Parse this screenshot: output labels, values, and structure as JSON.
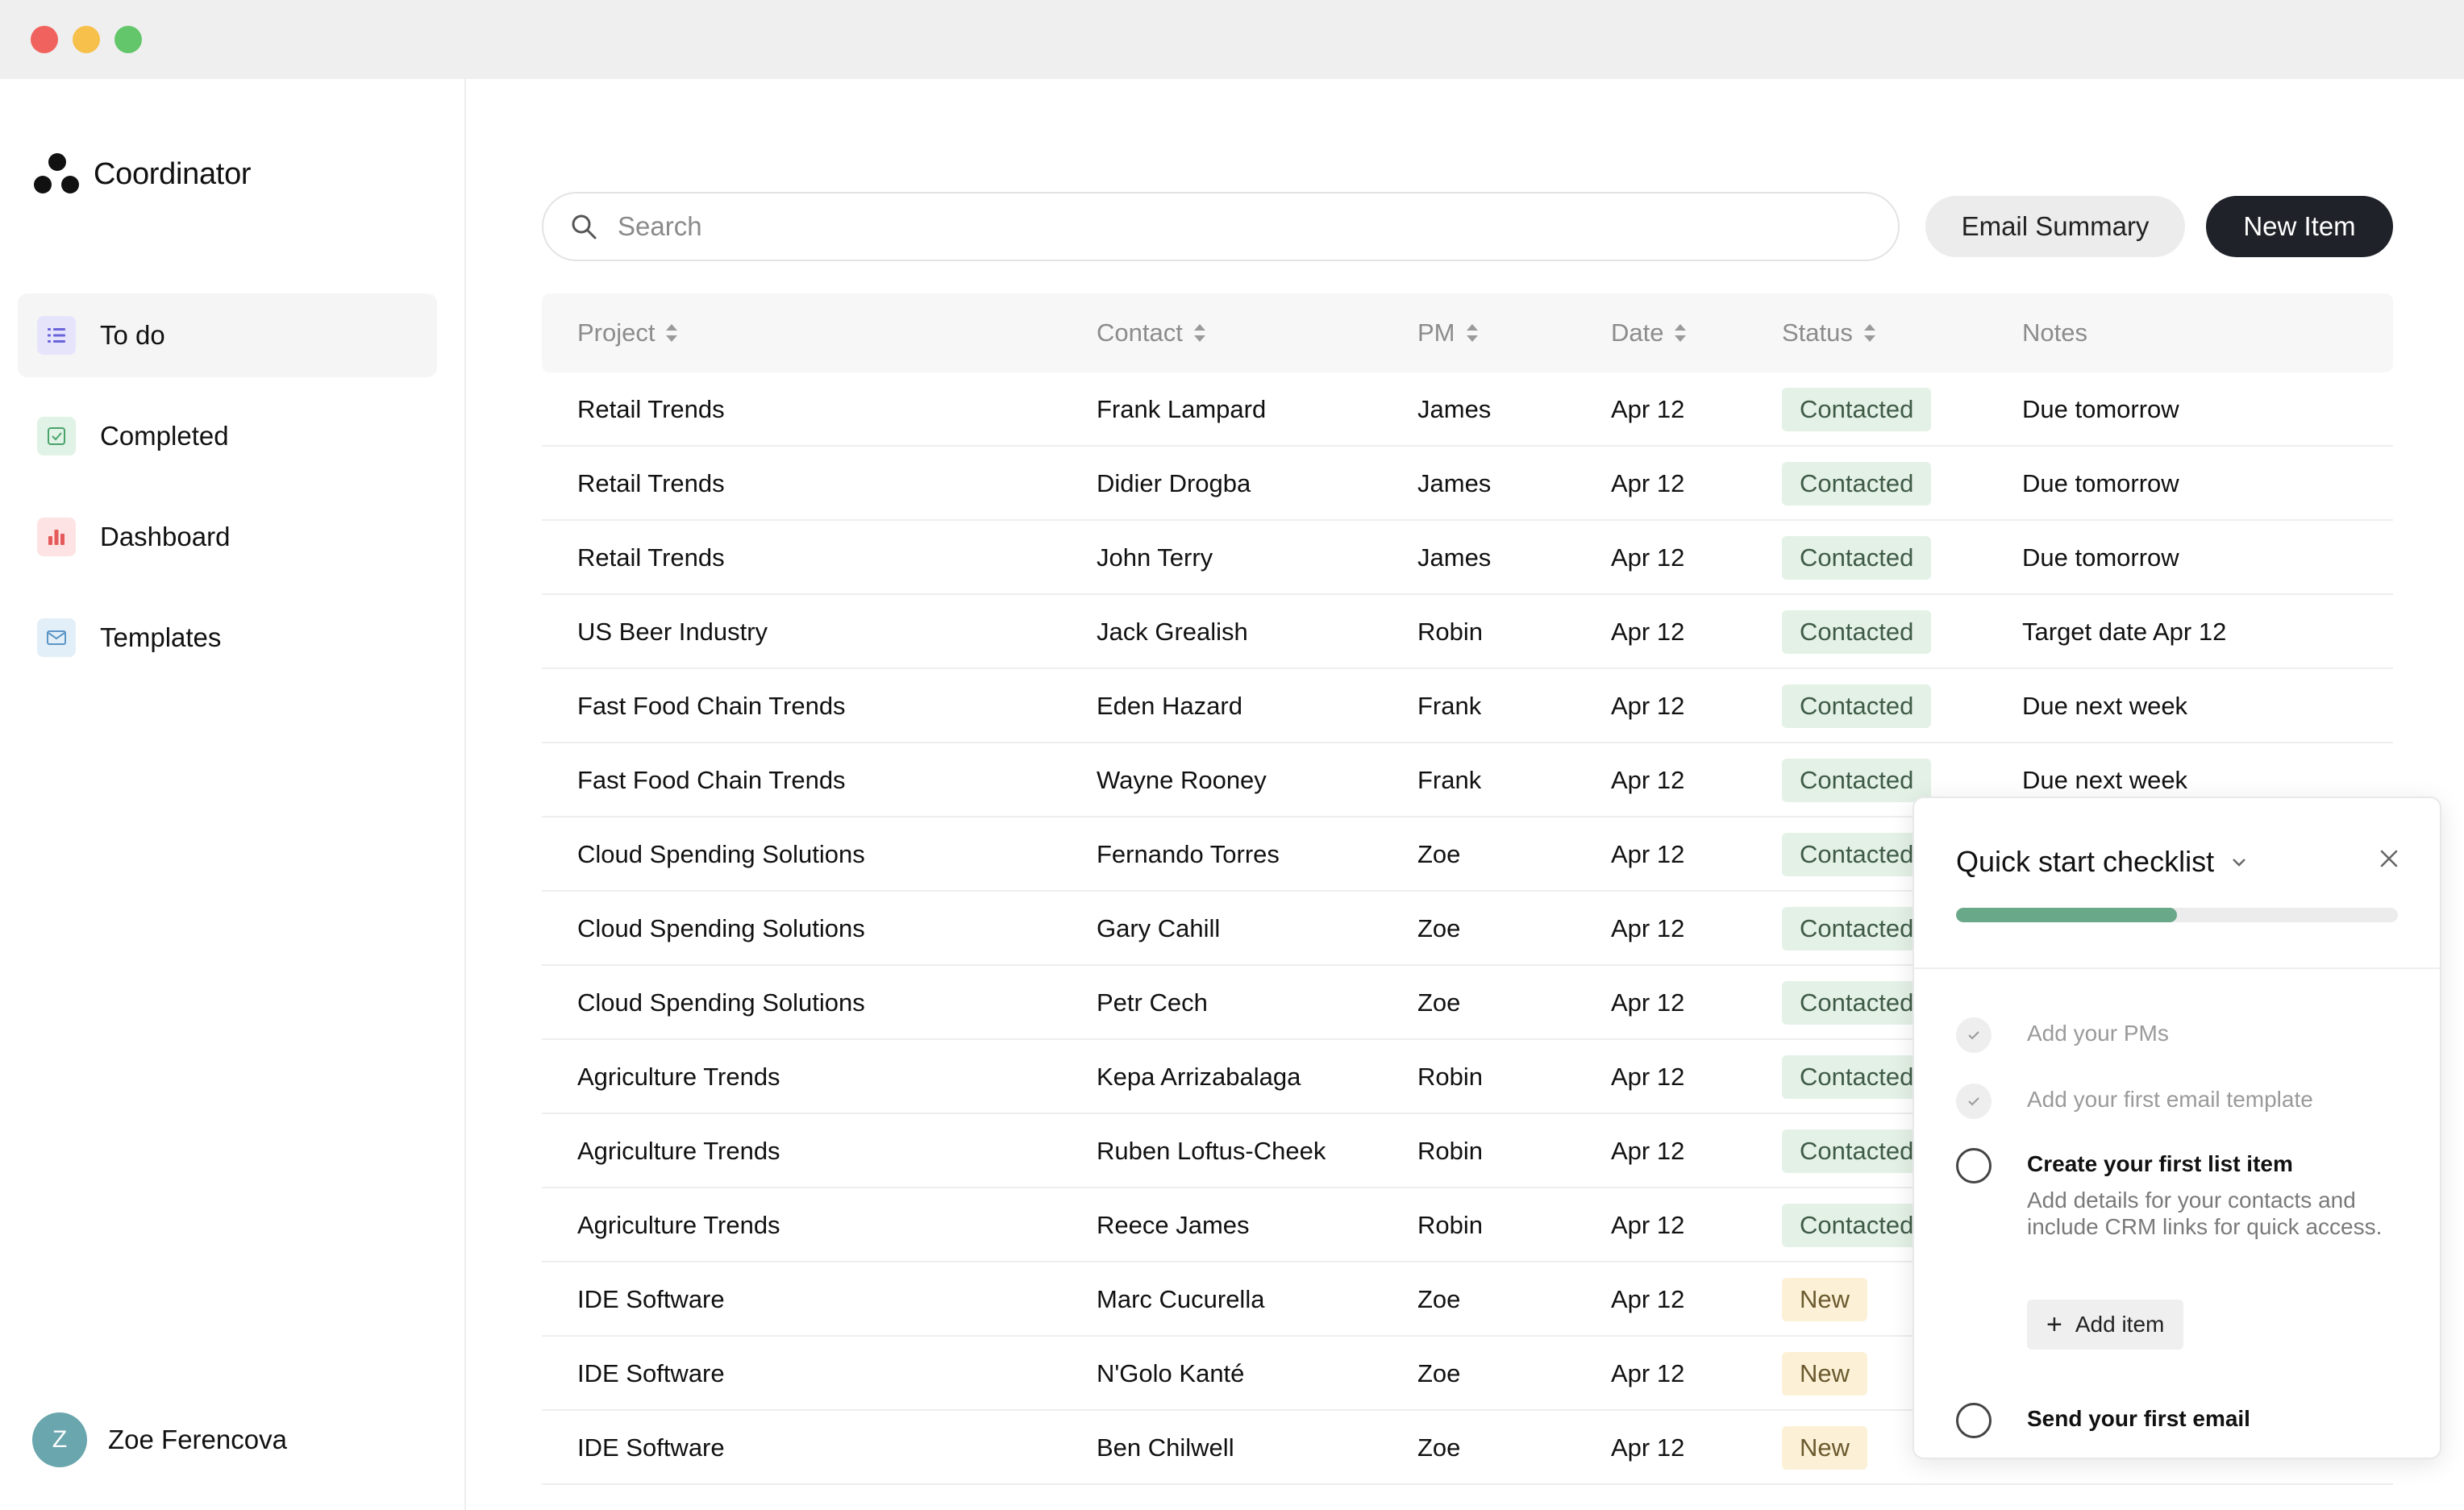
{
  "app": {
    "name": "Coordinator"
  },
  "sidebar": {
    "items": [
      {
        "label": "To do",
        "icon": "list-icon",
        "active": true
      },
      {
        "label": "Completed",
        "icon": "check-square-icon",
        "active": false
      },
      {
        "label": "Dashboard",
        "icon": "bar-chart-icon",
        "active": false
      },
      {
        "label": "Templates",
        "icon": "mail-icon",
        "active": false
      }
    ],
    "user": {
      "initial": "Z",
      "name": "Zoe Ferencova"
    }
  },
  "search": {
    "placeholder": "Search",
    "value": ""
  },
  "toolbar": {
    "email_summary_label": "Email Summary",
    "new_item_label": "New Item"
  },
  "table": {
    "headers": {
      "project": "Project",
      "contact": "Contact",
      "pm": "PM",
      "date": "Date",
      "status": "Status",
      "notes": "Notes"
    },
    "rows": [
      {
        "project": "Retail Trends",
        "contact": "Frank Lampard",
        "pm": "James",
        "date": "Apr 12",
        "status": "Contacted",
        "notes": "Due tomorrow"
      },
      {
        "project": "Retail Trends",
        "contact": "Didier Drogba",
        "pm": "James",
        "date": "Apr 12",
        "status": "Contacted",
        "notes": "Due tomorrow"
      },
      {
        "project": "Retail Trends",
        "contact": "John Terry",
        "pm": "James",
        "date": "Apr 12",
        "status": "Contacted",
        "notes": "Due tomorrow"
      },
      {
        "project": "US Beer Industry",
        "contact": "Jack Grealish",
        "pm": "Robin",
        "date": "Apr 12",
        "status": "Contacted",
        "notes": "Target date Apr 12"
      },
      {
        "project": "Fast Food Chain Trends",
        "contact": "Eden Hazard",
        "pm": "Frank",
        "date": "Apr 12",
        "status": "Contacted",
        "notes": "Due next week"
      },
      {
        "project": "Fast Food Chain Trends",
        "contact": "Wayne Rooney",
        "pm": "Frank",
        "date": "Apr 12",
        "status": "Contacted",
        "notes": "Due next week"
      },
      {
        "project": "Cloud Spending Solutions",
        "contact": "Fernando Torres",
        "pm": "Zoe",
        "date": "Apr 12",
        "status": "Contacted",
        "notes": ""
      },
      {
        "project": "Cloud Spending Solutions",
        "contact": "Gary Cahill",
        "pm": "Zoe",
        "date": "Apr 12",
        "status": "Contacted",
        "notes": ""
      },
      {
        "project": "Cloud Spending Solutions",
        "contact": "Petr Cech",
        "pm": "Zoe",
        "date": "Apr 12",
        "status": "Contacted",
        "notes": ""
      },
      {
        "project": "Agriculture Trends",
        "contact": "Kepa Arrizabalaga",
        "pm": "Robin",
        "date": "Apr 12",
        "status": "Contacted",
        "notes": ""
      },
      {
        "project": "Agriculture Trends",
        "contact": "Ruben Loftus-Cheek",
        "pm": "Robin",
        "date": "Apr 12",
        "status": "Contacted",
        "notes": ""
      },
      {
        "project": "Agriculture Trends",
        "contact": "Reece James",
        "pm": "Robin",
        "date": "Apr 12",
        "status": "Contacted",
        "notes": ""
      },
      {
        "project": "IDE Software",
        "contact": "Marc Cucurella",
        "pm": "Zoe",
        "date": "Apr 12",
        "status": "New",
        "notes": ""
      },
      {
        "project": "IDE Software",
        "contact": "N'Golo Kanté",
        "pm": "Zoe",
        "date": "Apr 12",
        "status": "New",
        "notes": ""
      },
      {
        "project": "IDE Software",
        "contact": "Ben Chilwell",
        "pm": "Zoe",
        "date": "Apr 12",
        "status": "New",
        "notes": ""
      }
    ]
  },
  "checklist": {
    "title": "Quick start checklist",
    "progress": 0.5,
    "items": [
      {
        "label": "Add your PMs",
        "done": true
      },
      {
        "label": "Add your first email template",
        "done": true
      },
      {
        "label": "Create your first list item",
        "done": false,
        "description": "Add details for your contacts and include CRM links for quick access.",
        "action_label": "Add item"
      },
      {
        "label": "Send your first email",
        "done": false
      }
    ]
  },
  "colors": {
    "accent_dark": "#1f2329",
    "contacted_bg": "#e4f1e6",
    "new_bg": "#fcf1d7",
    "progress_fill": "#6aa88a"
  }
}
